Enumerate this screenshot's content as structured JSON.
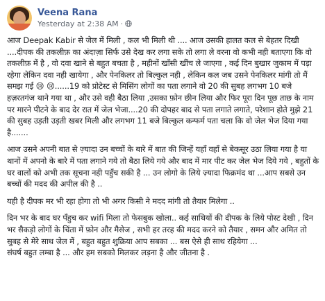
{
  "post": {
    "author": "Veena Rana",
    "timestamp": "Yesterday at 2:38 AM",
    "visibility_icon": "globe-icon",
    "paragraphs": [
      "आज Deepak Kabir से जेल में मिली , कल भी मिली थी .... आज उसकी हालत कल से बेहतर दिखी ....दीपक की तकलीफ़ का अंदाज़ा सिर्फ उसे देख कर लगा सके तो लगा ले वरना वो कभी नही बताएगा कि वो तकलीफ़ में है , वो दवा खाने से बहुत बचता है , महीनों खाँसी खींच ले जाएगा , कई दिन बुखार जुकाम में पड़ा रहेगा लेकिन दवा नही खायेगा , और पेनकिलर तो बिल्कुल नही , लेकिन कल जब उसने पेनकिलर मांगी तो मैं समझ गई 😢 😢......19 को प्रोटेस्ट से मिसिंग लोगों का पता लगाने वो 20 की सुबह लगभग 10 बजे हज़रतगंज थाने गया था , और उसे वही बैठा लिया ,उसका फ़ोन छीन लिया और फिर पूरा दिन पूछ ताछ के नाम पर मारने पीटने के बाद देर रात में जेल भेजा....20 की दोपहर बाद से पता लगाते लगाते, परेशान होते मुझे 21 की सुबह उड़ती उड़ती खबर मिली और लगभग 11 बजे बिल्कुल कन्फर्म पता चला कि वो जेल भेज दिया गया है.......",
      "आज उसने अपनी बात से ज़्यादा उन बच्चों के बारे में बात की जिन्हें यहाँ वहाँ से बेकसूर उठा लिया गया है या थानों में अपनो के बारे में पता लगाने गये तो बैठा लिये गये और बाद में मार पीट कर जेल भेज दिये गये , बहुतों के घर वालों को अभी तक सूचना नही पहुँच सकी है ... उन लोगो के लिये ज़्यादा फिक्रमंद था ...आप सबसे उन बच्चों की मदद की अपील की है ..",
      "यही है दीपक मर भी रहा होगा तो भी अगर किसी ने मदद मांगी तो तैयार मिलेगा ..",
      "दिन भर के बाद घर पँहुच कर wifi मिला तो फेसबुक खोला.. कई साथियों की दीपक के लिये पोस्ट देखी , दिन भर सैकड़ो लोगों के चिंता में फ़ोन और मैसेज , सभी हर तरह की मदद करने को तैयार , समन और अमित तो सुबह से मेरे साथ जेल में , बहुत बहुत शुक्रिया आप सबका ... बस ऐसे ही साथ रहियेगा ...\nसंघर्ष बहुत लम्बा है ... और हम सबको मिलकर लड़ना है और जीतना है ."
    ]
  }
}
